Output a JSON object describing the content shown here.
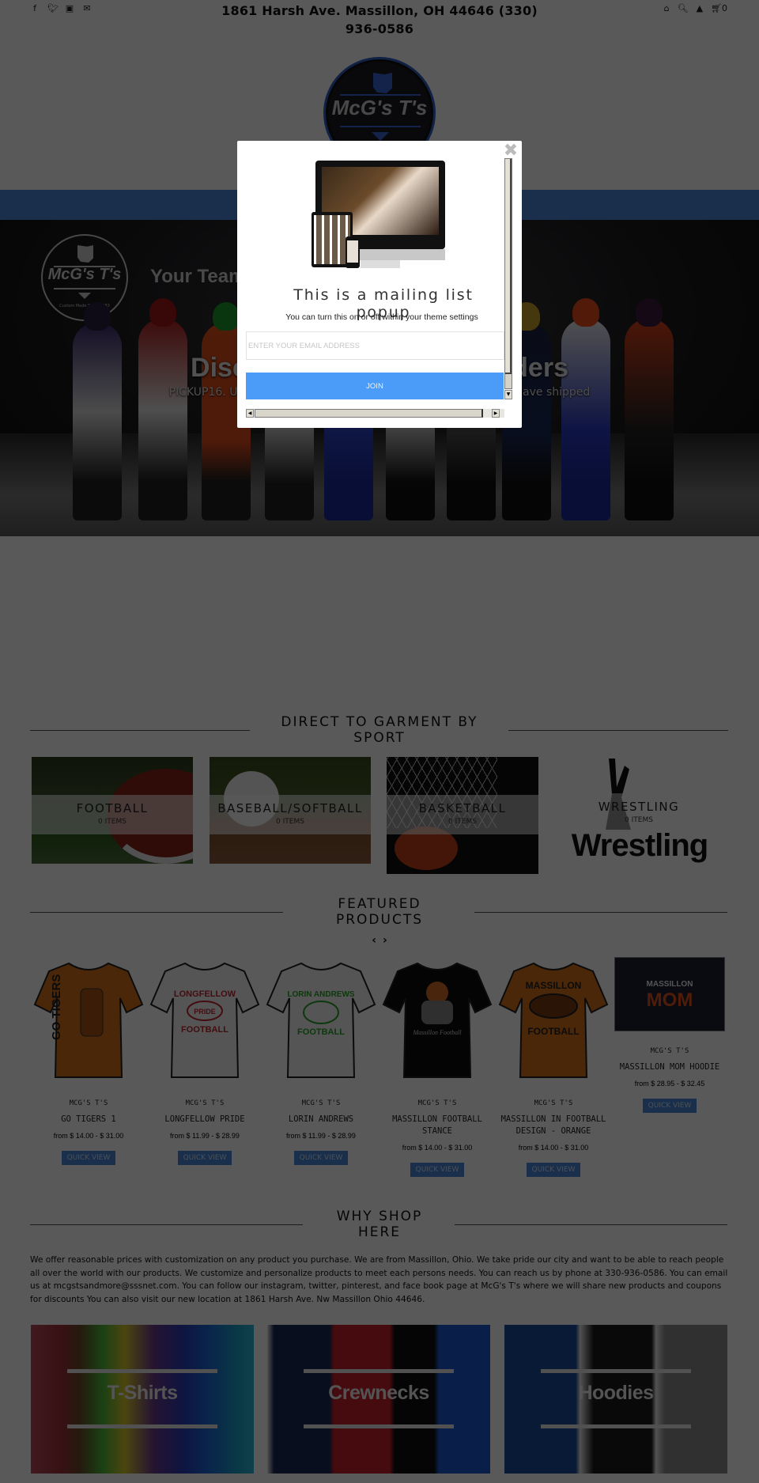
{
  "topbar": {
    "social_icons": [
      "facebook-icon",
      "twitter-icon",
      "instagram-icon",
      "email-icon"
    ],
    "address": "1861 Harsh Ave. Massillon, OH 44646 (330) 936-0586",
    "utility_icons": [
      "home-icon",
      "search-icon",
      "account-icon",
      "cart-icon"
    ],
    "cart_count": "0"
  },
  "logo": {
    "text": "McG's T's"
  },
  "hero": {
    "logo_text": "McG's T's",
    "logo_since": "Custom Made Since 1983",
    "tagline": "Your Team",
    "headline": "Discount on all pickup orders",
    "subtext": "PICKUP16. Use this code on orders that are for pickup and not have shipped"
  },
  "popup": {
    "title": "This is a mailing list popup",
    "subtitle": "You can turn this on or off within your theme settings",
    "email_placeholder": "ENTER YOUR EMAIL ADDRESS",
    "email_value": "",
    "join_label": "JOIN",
    "close_icon": "close-icon"
  },
  "collections_section": {
    "title_line1": "DIRECT TO GARMENT BY",
    "title_line2": "SPORT",
    "items": [
      {
        "name": "FOOTBALL",
        "count": "0 ITEMS"
      },
      {
        "name": "BASEBALL/SOFTBALL",
        "count": "0 ITEMS"
      },
      {
        "name": "BASKETBALL",
        "count": "0 ITEMS"
      },
      {
        "name": "WRESTLING",
        "count": "0 ITEMS",
        "image_text": "Wrestling"
      }
    ]
  },
  "featured_section": {
    "title_line1": "FEATURED",
    "title_line2": "PRODUCTS",
    "prev": "‹",
    "next": "›",
    "products": [
      {
        "vendor": "MCG'S T'S",
        "title": "GO TIGERS 1",
        "price": "from $ 14.00 - $ 31.00",
        "quick_view": "QUICK VIEW",
        "print": "GO TIGERS"
      },
      {
        "vendor": "MCG'S T'S",
        "title": "LONGFELLOW PRIDE",
        "price": "from $ 11.99 - $ 28.99",
        "quick_view": "QUICK VIEW",
        "print_top": "LONGFELLOW",
        "print_mid": "PRIDE",
        "print_bottom": "FOOTBALL"
      },
      {
        "vendor": "MCG'S T'S",
        "title": "LORIN ANDREWS",
        "price": "from $ 11.99 - $ 28.99",
        "quick_view": "QUICK VIEW",
        "print_top": "LORIN ANDREWS",
        "print_bottom": "FOOTBALL"
      },
      {
        "vendor": "MCG'S T'S",
        "title": "MASSILLON FOOTBALL STANCE",
        "price": "from $ 14.00 - $ 31.00",
        "quick_view": "QUICK VIEW",
        "print": "Massillon Football"
      },
      {
        "vendor": "MCG'S T'S",
        "title": "MASSILLON IN FOOTBALL DESIGN - ORANGE",
        "price": "from $ 14.00 - $ 31.00",
        "quick_view": "QUICK VIEW",
        "print_top": "MASSILLON",
        "print_bottom": "FOOTBALL"
      },
      {
        "vendor": "MCG'S T'S",
        "title": "MASSILLON MOM HOODIE",
        "price": "from $ 28.95 - $ 32.45",
        "quick_view": "QUICK VIEW",
        "print_top": "MASSILLON",
        "print_bottom": "MOM"
      }
    ]
  },
  "why_section": {
    "title_line1": "WHY SHOP",
    "title_line2": "HERE",
    "body": "We offer reasonable prices with customization on any product you purchase. We are from Massillon, Ohio. We take pride our city and want to be able to reach people all over the world with our products.  We customize and personalize products to meet each persons needs.  You can reach us by phone at 330-936-0586.  You can email us at mcgstsandmore@sssnet.com.  You can follow our instagram, twitter, pinterest, and face book page at McG's T's where we will share new products and coupons for discounts You can also visit our new location at 1861 Harsh Ave. Nw Massillon Ohio 44646."
  },
  "garment_tiles": [
    {
      "label": "T-Shirts"
    },
    {
      "label": "Crewnecks"
    },
    {
      "label": "Hoodies"
    }
  ]
}
